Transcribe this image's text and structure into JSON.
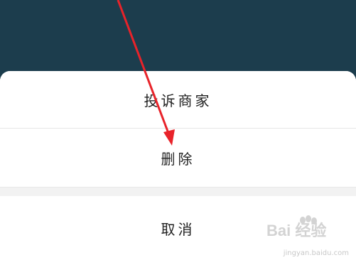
{
  "action_sheet": {
    "items": [
      {
        "label": "投诉商家"
      },
      {
        "label": "删除"
      }
    ],
    "cancel_label": "取消"
  },
  "annotation": {
    "arrow_color": "#e8232a"
  },
  "watermark": {
    "logo_text": "Bai 经验",
    "url": "jingyan.baidu.com"
  },
  "colors": {
    "background": "#1c3d4d",
    "sheet": "#ffffff",
    "separator": "#f2f2f2",
    "text": "#222222"
  }
}
